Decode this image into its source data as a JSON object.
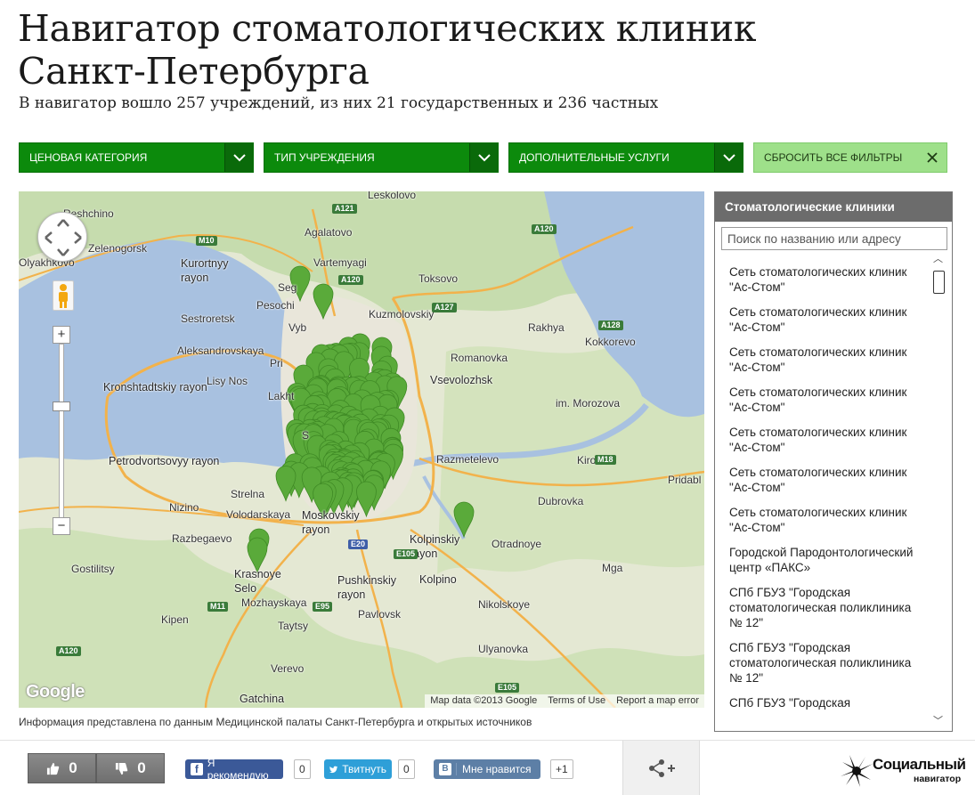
{
  "header": {
    "title": "Навигатор стоматологических клиник Санкт-Петербурга",
    "subtitle": "В навигатор вошло 257 учреждений, из них 21 государственных и 236 частных"
  },
  "filters": [
    {
      "label": "ЦЕНОВАЯ КАТЕГОРИЯ",
      "icon": "chevron-down-icon"
    },
    {
      "label": "ТИП УЧРЕЖДЕНИЯ",
      "icon": "chevron-down-icon"
    },
    {
      "label": "ДОПОЛНИТЕЛЬНЫЕ УСЛУГИ",
      "icon": "chevron-down-icon"
    },
    {
      "label": "СБРОСИТЬ ВСЕ ФИЛЬТРЫ",
      "icon": "close-icon"
    }
  ],
  "map": {
    "labels": [
      "Leskolovo",
      "Agalatovo",
      "Vartemyagi",
      "Toksovo",
      "Kuzmolovskiy",
      "Rakhya",
      "Kokkorevo",
      "Romanovka",
      "Vsevolozhsk",
      "im. Morozova",
      "Razmetelevo",
      "Kirovsk",
      "Pridabl",
      "Dubrovka",
      "Otradnoye",
      "Kolpinskiy rayon",
      "Kolpino",
      "Mga",
      "Nikolskoye",
      "Ulyanovka",
      "Pushkinskiy rayon",
      "Pavlovsk",
      "Taytsy",
      "Verevo",
      "Gatchina",
      "Mozhayskaya",
      "Kipen",
      "Gostilitsy",
      "Razbegaevo",
      "Nizino",
      "Strelna",
      "Volodarskaya",
      "Moskovskiy rayon",
      "Petrodvortsovyy rayon",
      "Kronshtadtskiy rayon",
      "Lisy Nos",
      "Aleksandrovskaya",
      "Sestroretsk",
      "Kurortnyy rayon",
      "Zelenogorsk",
      "Reshchino",
      "Olyakhkovo",
      "Pesochi",
      "Pri",
      "Lakht",
      "Krasnoye Selo",
      "Seg",
      "Vyb",
      "S"
    ],
    "road_shields": [
      "A121",
      "E105",
      "M10",
      "A127",
      "A120",
      "A128",
      "M18",
      "A120",
      "E95",
      "M11",
      "E20",
      "A120",
      "E105"
    ],
    "footer": {
      "data": "Map data ©2013 Google",
      "terms": "Terms of Use",
      "report": "Report a map error"
    },
    "logo": "Google",
    "zoom_in": "+",
    "zoom_out": "−",
    "marker_color": "#5aaa3a"
  },
  "panel": {
    "title": "Стоматологические клиники",
    "search_placeholder": "Поиск по названию или адресу",
    "clinics": [
      "Сеть стоматологических клиник \"Ас-Стом\"",
      "Сеть стоматологических клиник \"Ас-Стом\"",
      "Сеть стоматологических клиник \"Ас-Стом\"",
      "Сеть стоматологических клиник \"Ас-Стом\"",
      "Сеть стоматологических клиник \"Ас-Стом\"",
      "Сеть стоматологических клиник \"Ас-Стом\"",
      "Сеть стоматологических клиник \"Ас-Стом\"",
      "Городской Пародонтологический центр «ПАКС»",
      "СПб ГБУЗ \"Городская стоматологическая поликлиника № 12\"",
      "СПб ГБУЗ \"Городская стоматологическая поликлиника № 12\"",
      "СПб ГБУЗ \"Городская"
    ]
  },
  "caption": "Информация представлена по данным Медицинской палаты Санкт-Петербурга и открытых источников",
  "footer": {
    "like_count": "0",
    "dislike_count": "0",
    "fb_label": "Я рекомендую",
    "fb_count": "0",
    "tw_label": "Твитнуть",
    "tw_count": "0",
    "vk_label": "Мне нравится",
    "vk_count": "+1",
    "brand_name": "Социальный",
    "brand_sub": "навигатор"
  }
}
